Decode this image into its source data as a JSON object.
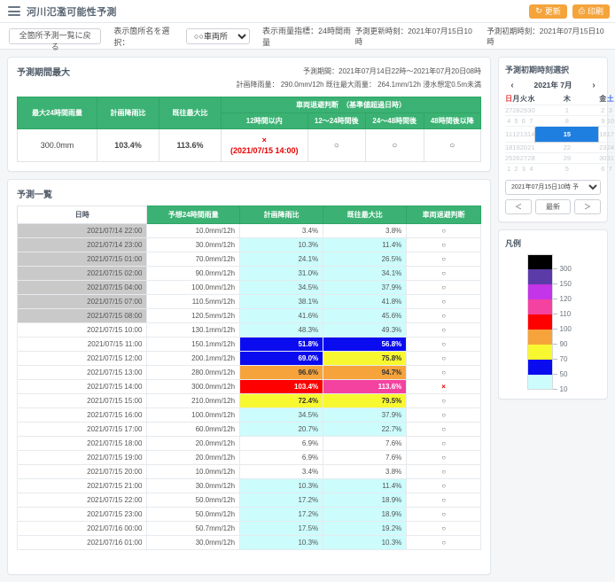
{
  "header": {
    "menu_icon": "hamburger-icon",
    "title": "河川氾濫可能性予測",
    "refresh_label": "更新",
    "refresh_icon": "refresh-icon",
    "print_label": "印刷",
    "print_icon": "printer-icon"
  },
  "toolbar": {
    "back_label": "全箇所予測一覧に戻る",
    "select_label": "表示箇所名を選択：",
    "selected_site": "○○車両所",
    "site_options": [
      "○○車両所"
    ],
    "metric_label": "表示雨量指標：24時間雨量",
    "update_time_label": "予測更新時刻：2021年07月15日10時",
    "init_time_label": "予測初期時刻：2021年07月15日10時"
  },
  "max_panel": {
    "title": "予測期間最大",
    "period_label": "予測期間：2021年07月14日22時～2021年07月20日08時",
    "design_label": "計画降雨量： 290.0mm/12h  既往最大雨量： 264.1mm/12h  浸水想定0.5m未満",
    "headers": {
      "max24": "最大24時間雨量",
      "plan_ratio": "計画降雨比",
      "past_ratio": "既往最大比",
      "judgement_group": "車両退避判断　（基準値超過日時）",
      "sub": [
        "12時間以内",
        "12～24時間後",
        "24～48時間後",
        "48時間後以降"
      ]
    },
    "row": {
      "max24": "300.0mm",
      "plan_ratio": "103.4%",
      "past_ratio": "113.6%",
      "judge_within12_mark": "×",
      "judge_within12_datetime": "(2021/07/15 14:00)",
      "judge_12_24": "○",
      "judge_24_48": "○",
      "judge_48plus": "○"
    }
  },
  "list_panel": {
    "title": "予測一覧",
    "columns": [
      "日時",
      "予想24時間雨量",
      "計画降雨比",
      "既往最大比",
      "車両退避判断"
    ],
    "rows": [
      {
        "datetime": "2021/07/14 22:00",
        "rain": "10.0mm/12h",
        "plan": "3.4%",
        "plan_c": "none",
        "past": "3.8%",
        "past_c": "none",
        "judge": "○",
        "judge_x": false,
        "dt_gray": true
      },
      {
        "datetime": "2021/07/14 23:00",
        "rain": "30.0mm/12h",
        "plan": "10.3%",
        "plan_c": "10",
        "past": "11.4%",
        "past_c": "10",
        "judge": "○",
        "judge_x": false,
        "dt_gray": true
      },
      {
        "datetime": "2021/07/15 01:00",
        "rain": "70.0mm/12h",
        "plan": "24.1%",
        "plan_c": "10",
        "past": "26.5%",
        "past_c": "10",
        "judge": "○",
        "judge_x": false,
        "dt_gray": true
      },
      {
        "datetime": "2021/07/15 02:00",
        "rain": "90.0mm/12h",
        "plan": "31.0%",
        "plan_c": "10",
        "past": "34.1%",
        "past_c": "10",
        "judge": "○",
        "judge_x": false,
        "dt_gray": true
      },
      {
        "datetime": "2021/07/15 04:00",
        "rain": "100.0mm/12h",
        "plan": "34.5%",
        "plan_c": "10",
        "past": "37.9%",
        "past_c": "10",
        "judge": "○",
        "judge_x": false,
        "dt_gray": true
      },
      {
        "datetime": "2021/07/15 07:00",
        "rain": "110.5mm/12h",
        "plan": "38.1%",
        "plan_c": "10",
        "past": "41.8%",
        "past_c": "10",
        "judge": "○",
        "judge_x": false,
        "dt_gray": true
      },
      {
        "datetime": "2021/07/15 08:00",
        "rain": "120.5mm/12h",
        "plan": "41.6%",
        "plan_c": "10",
        "past": "45.6%",
        "past_c": "10",
        "judge": "○",
        "judge_x": false,
        "dt_gray": true
      },
      {
        "datetime": "2021/07/15 10:00",
        "rain": "130.1mm/12h",
        "plan": "48.3%",
        "plan_c": "10",
        "past": "49.3%",
        "past_c": "10",
        "judge": "○",
        "judge_x": false,
        "dt_gray": false
      },
      {
        "datetime": "2021/07/15 11:00",
        "rain": "150.1mm/12h",
        "plan": "51.8%",
        "plan_c": "50",
        "past": "56.8%",
        "past_c": "50",
        "judge": "○",
        "judge_x": false,
        "dt_gray": false
      },
      {
        "datetime": "2021/07/15 12:00",
        "rain": "200.1mm/12h",
        "plan": "69.0%",
        "plan_c": "50",
        "past": "75.8%",
        "past_c": "70",
        "judge": "○",
        "judge_x": false,
        "dt_gray": false
      },
      {
        "datetime": "2021/07/15 13:00",
        "rain": "280.0mm/12h",
        "plan": "96.6%",
        "plan_c": "90",
        "past": "94.7%",
        "past_c": "90",
        "judge": "○",
        "judge_x": false,
        "dt_gray": false
      },
      {
        "datetime": "2021/07/15 14:00",
        "rain": "300.0mm/12h",
        "plan": "103.4%",
        "plan_c": "100",
        "past": "113.6%",
        "past_c": "110",
        "judge": "×",
        "judge_x": true,
        "dt_gray": false
      },
      {
        "datetime": "2021/07/15 15:00",
        "rain": "210.0mm/12h",
        "plan": "72.4%",
        "plan_c": "70",
        "past": "79.5%",
        "past_c": "70",
        "judge": "○",
        "judge_x": false,
        "dt_gray": false
      },
      {
        "datetime": "2021/07/15 16:00",
        "rain": "100.0mm/12h",
        "plan": "34.5%",
        "plan_c": "10",
        "past": "37.9%",
        "past_c": "10",
        "judge": "○",
        "judge_x": false,
        "dt_gray": false
      },
      {
        "datetime": "2021/07/15 17:00",
        "rain": "60.0mm/12h",
        "plan": "20.7%",
        "plan_c": "10",
        "past": "22.7%",
        "past_c": "10",
        "judge": "○",
        "judge_x": false,
        "dt_gray": false
      },
      {
        "datetime": "2021/07/15 18:00",
        "rain": "20.0mm/12h",
        "plan": "6.9%",
        "plan_c": "none",
        "past": "7.6%",
        "past_c": "none",
        "judge": "○",
        "judge_x": false,
        "dt_gray": false
      },
      {
        "datetime": "2021/07/15 19:00",
        "rain": "20.0mm/12h",
        "plan": "6.9%",
        "plan_c": "none",
        "past": "7.6%",
        "past_c": "none",
        "judge": "○",
        "judge_x": false,
        "dt_gray": false
      },
      {
        "datetime": "2021/07/15 20:00",
        "rain": "10.0mm/12h",
        "plan": "3.4%",
        "plan_c": "none",
        "past": "3.8%",
        "past_c": "none",
        "judge": "○",
        "judge_x": false,
        "dt_gray": false
      },
      {
        "datetime": "2021/07/15 21:00",
        "rain": "30.0mm/12h",
        "plan": "10.3%",
        "plan_c": "10",
        "past": "11.4%",
        "past_c": "10",
        "judge": "○",
        "judge_x": false,
        "dt_gray": false
      },
      {
        "datetime": "2021/07/15 22:00",
        "rain": "50.0mm/12h",
        "plan": "17.2%",
        "plan_c": "10",
        "past": "18.9%",
        "past_c": "10",
        "judge": "○",
        "judge_x": false,
        "dt_gray": false
      },
      {
        "datetime": "2021/07/15 23:00",
        "rain": "50.0mm/12h",
        "plan": "17.2%",
        "plan_c": "10",
        "past": "18.9%",
        "past_c": "10",
        "judge": "○",
        "judge_x": false,
        "dt_gray": false
      },
      {
        "datetime": "2021/07/16 00:00",
        "rain": "50.7mm/12h",
        "plan": "17.5%",
        "plan_c": "10",
        "past": "19.2%",
        "past_c": "10",
        "judge": "○",
        "judge_x": false,
        "dt_gray": false
      },
      {
        "datetime": "2021/07/16 01:00",
        "rain": "30.0mm/12h",
        "plan": "10.3%",
        "plan_c": "10",
        "past": "10.3%",
        "past_c": "10",
        "judge": "○",
        "judge_x": false,
        "dt_gray": false
      }
    ]
  },
  "calendar": {
    "title": "予測初期時刻選択",
    "prev_icon": "chevron-left-icon",
    "next_icon": "chevron-right-icon",
    "month_label": "2021年 7月",
    "weekdays": [
      "日",
      "月",
      "火",
      "水",
      "木",
      "金",
      "土"
    ],
    "weeks": [
      [
        {
          "d": "27",
          "o": true
        },
        {
          "d": "28",
          "o": true
        },
        {
          "d": "29",
          "o": true
        },
        {
          "d": "30",
          "o": true
        },
        {
          "d": "1",
          "o": true
        },
        {
          "d": "2",
          "o": true
        },
        {
          "d": "3",
          "o": true
        }
      ],
      [
        {
          "d": "4",
          "o": true
        },
        {
          "d": "5",
          "o": true
        },
        {
          "d": "6",
          "o": true
        },
        {
          "d": "7",
          "o": true
        },
        {
          "d": "8",
          "o": true
        },
        {
          "d": "9",
          "o": true
        },
        {
          "d": "10",
          "o": true
        }
      ],
      [
        {
          "d": "11",
          "o": true
        },
        {
          "d": "12",
          "o": true
        },
        {
          "d": "13",
          "o": true
        },
        {
          "d": "14",
          "o": true
        },
        {
          "d": "15",
          "o": false,
          "sel": true
        },
        {
          "d": "16",
          "o": true
        },
        {
          "d": "17",
          "o": true
        }
      ],
      [
        {
          "d": "18",
          "o": true
        },
        {
          "d": "19",
          "o": true
        },
        {
          "d": "20",
          "o": true
        },
        {
          "d": "21",
          "o": true
        },
        {
          "d": "22",
          "o": true
        },
        {
          "d": "23",
          "o": true
        },
        {
          "d": "24",
          "o": true
        }
      ],
      [
        {
          "d": "25",
          "o": true
        },
        {
          "d": "26",
          "o": true
        },
        {
          "d": "27",
          "o": true
        },
        {
          "d": "28",
          "o": true
        },
        {
          "d": "29",
          "o": true
        },
        {
          "d": "30",
          "o": true
        },
        {
          "d": "31",
          "o": true
        }
      ],
      [
        {
          "d": "1",
          "o": true
        },
        {
          "d": "2",
          "o": true
        },
        {
          "d": "3",
          "o": true
        },
        {
          "d": "4",
          "o": true
        },
        {
          "d": "5",
          "o": true
        },
        {
          "d": "6",
          "o": true
        },
        {
          "d": "7",
          "o": true
        }
      ]
    ],
    "time_selected": "2021年07月15日10時 予",
    "time_options": [
      "2021年07月15日10時 予"
    ],
    "prev_button": "＜",
    "latest_button": "最新",
    "next_button": "＞"
  },
  "legend": {
    "title": "凡例",
    "bands": [
      {
        "color": "#000000",
        "label": "300"
      },
      {
        "color": "#5b3ba8",
        "label": "150"
      },
      {
        "color": "#c434e8",
        "label": "120"
      },
      {
        "color": "#f442a0",
        "label": "110"
      },
      {
        "color": "#ff0000",
        "label": "100"
      },
      {
        "color": "#f7a33c",
        "label": "90"
      },
      {
        "color": "#f8f830",
        "label": "70"
      },
      {
        "color": "#0b0bf0",
        "label": "50"
      },
      {
        "color": "#ccfcfc",
        "label": "10"
      }
    ]
  }
}
